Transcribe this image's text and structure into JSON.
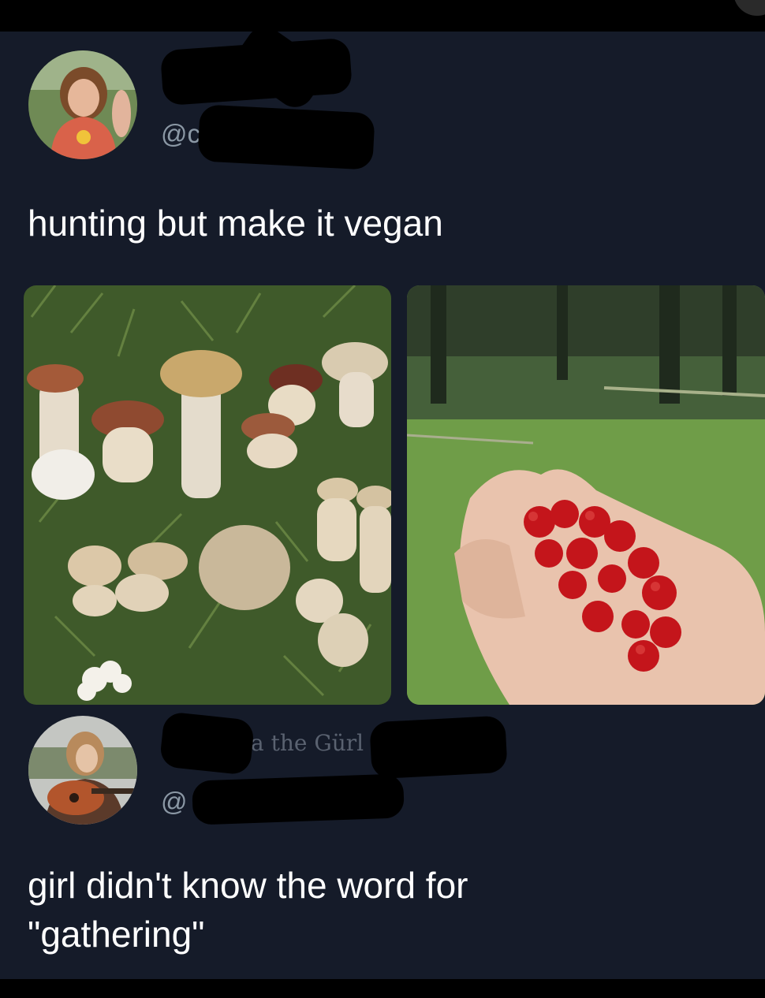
{
  "tweet1": {
    "handle_prefix": "@c",
    "text": "hunting but make it vegan",
    "media": [
      {
        "name": "mushrooms-photo"
      },
      {
        "name": "berries-in-hand-photo"
      }
    ]
  },
  "tweet2": {
    "name_fragment": "a the Gürl",
    "handle_prefix": "@",
    "text_line1": "girl didn't know the word for",
    "text_line2": "\"gathering\""
  },
  "colors": {
    "background": "#151b29",
    "text": "#ffffff",
    "handle": "#8b98a5",
    "redaction": "#000000"
  }
}
